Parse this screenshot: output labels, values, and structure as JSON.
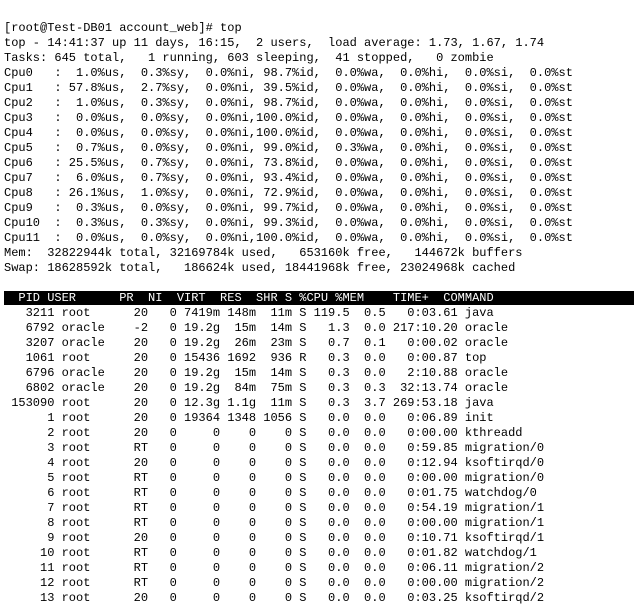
{
  "prompt": "[root@Test-DB01 account_web]# ",
  "cmd": "top",
  "summary": {
    "line1": "top - 14:41:37 up 11 days, 16:15,  2 users,  load average: 1.73, 1.67, 1.74",
    "line2": "Tasks: 645 total,   1 running, 603 sleeping,  41 stopped,   0 zombie"
  },
  "cpu": [
    {
      "n": "Cpu0 ",
      "us": " 1.0",
      "sy": "0.3",
      "ni": "0.0",
      "id": " 98.7",
      "wa": "0.0",
      "hi": "0.0",
      "si": "0.0",
      "st": "0.0"
    },
    {
      "n": "Cpu1 ",
      "us": "57.8",
      "sy": "2.7",
      "ni": "0.0",
      "id": " 39.5",
      "wa": "0.0",
      "hi": "0.0",
      "si": "0.0",
      "st": "0.0"
    },
    {
      "n": "Cpu2 ",
      "us": " 1.0",
      "sy": "0.3",
      "ni": "0.0",
      "id": " 98.7",
      "wa": "0.0",
      "hi": "0.0",
      "si": "0.0",
      "st": "0.0"
    },
    {
      "n": "Cpu3 ",
      "us": " 0.0",
      "sy": "0.0",
      "ni": "0.0",
      "id": "100.0",
      "wa": "0.0",
      "hi": "0.0",
      "si": "0.0",
      "st": "0.0"
    },
    {
      "n": "Cpu4 ",
      "us": " 0.0",
      "sy": "0.0",
      "ni": "0.0",
      "id": "100.0",
      "wa": "0.0",
      "hi": "0.0",
      "si": "0.0",
      "st": "0.0"
    },
    {
      "n": "Cpu5 ",
      "us": " 0.7",
      "sy": "0.0",
      "ni": "0.0",
      "id": " 99.0",
      "wa": "0.3",
      "hi": "0.0",
      "si": "0.0",
      "st": "0.0"
    },
    {
      "n": "Cpu6 ",
      "us": "25.5",
      "sy": "0.7",
      "ni": "0.0",
      "id": " 73.8",
      "wa": "0.0",
      "hi": "0.0",
      "si": "0.0",
      "st": "0.0"
    },
    {
      "n": "Cpu7 ",
      "us": " 6.0",
      "sy": "0.7",
      "ni": "0.0",
      "id": " 93.4",
      "wa": "0.0",
      "hi": "0.0",
      "si": "0.0",
      "st": "0.0"
    },
    {
      "n": "Cpu8 ",
      "us": "26.1",
      "sy": "1.0",
      "ni": "0.0",
      "id": " 72.9",
      "wa": "0.0",
      "hi": "0.0",
      "si": "0.0",
      "st": "0.0"
    },
    {
      "n": "Cpu9 ",
      "us": " 0.3",
      "sy": "0.0",
      "ni": "0.0",
      "id": " 99.7",
      "wa": "0.0",
      "hi": "0.0",
      "si": "0.0",
      "st": "0.0"
    },
    {
      "n": "Cpu10",
      "us": " 0.3",
      "sy": "0.3",
      "ni": "0.0",
      "id": " 99.3",
      "wa": "0.0",
      "hi": "0.0",
      "si": "0.0",
      "st": "0.0"
    },
    {
      "n": "Cpu11",
      "us": " 0.0",
      "sy": "0.0",
      "ni": "0.0",
      "id": "100.0",
      "wa": "0.0",
      "hi": "0.0",
      "si": "0.0",
      "st": "0.0"
    }
  ],
  "mem": {
    "line": "Mem:  32822944k total, 32169784k used,   653160k free,   144672k buffers",
    "swap": "Swap: 18628592k total,   186624k used, 18441968k free, 23024968k cached"
  },
  "header": "  PID USER      PR  NI  VIRT  RES  SHR S %CPU %MEM    TIME+  COMMAND",
  "rows": [
    {
      "pid": "   3211",
      "user": "root    ",
      "pr": "20",
      "ni": "  0",
      "virt": "7419m",
      "res": "148m",
      "shr": " 11m",
      "s": "S",
      "cpu": "119.5",
      "mem": "0.5",
      "time": "  0:03.61",
      "cmd": "java"
    },
    {
      "pid": "   6792",
      "user": "oracle  ",
      "pr": "-2",
      "ni": "  0",
      "virt": "19.2g",
      "res": " 15m",
      "shr": " 14m",
      "s": "S",
      "cpu": "  1.3",
      "mem": "0.0",
      "time": "217:10.20",
      "cmd": "oracle"
    },
    {
      "pid": "   3207",
      "user": "oracle  ",
      "pr": "20",
      "ni": "  0",
      "virt": "19.2g",
      "res": " 26m",
      "shr": " 23m",
      "s": "S",
      "cpu": "  0.7",
      "mem": "0.1",
      "time": "  0:00.02",
      "cmd": "oracle"
    },
    {
      "pid": "   1061",
      "user": "root    ",
      "pr": "20",
      "ni": "  0",
      "virt": "15436",
      "res": "1692",
      "shr": " 936",
      "s": "R",
      "cpu": "  0.3",
      "mem": "0.0",
      "time": "  0:00.87",
      "cmd": "top"
    },
    {
      "pid": "   6796",
      "user": "oracle  ",
      "pr": "20",
      "ni": "  0",
      "virt": "19.2g",
      "res": " 15m",
      "shr": " 14m",
      "s": "S",
      "cpu": "  0.3",
      "mem": "0.0",
      "time": "  2:10.88",
      "cmd": "oracle"
    },
    {
      "pid": "   6802",
      "user": "oracle  ",
      "pr": "20",
      "ni": "  0",
      "virt": "19.2g",
      "res": " 84m",
      "shr": " 75m",
      "s": "S",
      "cpu": "  0.3",
      "mem": "0.3",
      "time": " 32:13.74",
      "cmd": "oracle"
    },
    {
      "pid": " 153090",
      "user": "root    ",
      "pr": "20",
      "ni": "  0",
      "virt": "12.3g",
      "res": "1.1g",
      "shr": " 11m",
      "s": "S",
      "cpu": "  0.3",
      "mem": "3.7",
      "time": "269:53.18",
      "cmd": "java"
    },
    {
      "pid": "      1",
      "user": "root    ",
      "pr": "20",
      "ni": "  0",
      "virt": "19364",
      "res": "1348",
      "shr": "1056",
      "s": "S",
      "cpu": "  0.0",
      "mem": "0.0",
      "time": "  0:06.89",
      "cmd": "init"
    },
    {
      "pid": "      2",
      "user": "root    ",
      "pr": "20",
      "ni": "  0",
      "virt": "    0",
      "res": "   0",
      "shr": "   0",
      "s": "S",
      "cpu": "  0.0",
      "mem": "0.0",
      "time": "  0:00.00",
      "cmd": "kthreadd"
    },
    {
      "pid": "      3",
      "user": "root    ",
      "pr": "RT",
      "ni": "  0",
      "virt": "    0",
      "res": "   0",
      "shr": "   0",
      "s": "S",
      "cpu": "  0.0",
      "mem": "0.0",
      "time": "  0:59.85",
      "cmd": "migration/0"
    },
    {
      "pid": "      4",
      "user": "root    ",
      "pr": "20",
      "ni": "  0",
      "virt": "    0",
      "res": "   0",
      "shr": "   0",
      "s": "S",
      "cpu": "  0.0",
      "mem": "0.0",
      "time": "  0:12.94",
      "cmd": "ksoftirqd/0"
    },
    {
      "pid": "      5",
      "user": "root    ",
      "pr": "RT",
      "ni": "  0",
      "virt": "    0",
      "res": "   0",
      "shr": "   0",
      "s": "S",
      "cpu": "  0.0",
      "mem": "0.0",
      "time": "  0:00.00",
      "cmd": "migration/0"
    },
    {
      "pid": "      6",
      "user": "root    ",
      "pr": "RT",
      "ni": "  0",
      "virt": "    0",
      "res": "   0",
      "shr": "   0",
      "s": "S",
      "cpu": "  0.0",
      "mem": "0.0",
      "time": "  0:01.75",
      "cmd": "watchdog/0"
    },
    {
      "pid": "      7",
      "user": "root    ",
      "pr": "RT",
      "ni": "  0",
      "virt": "    0",
      "res": "   0",
      "shr": "   0",
      "s": "S",
      "cpu": "  0.0",
      "mem": "0.0",
      "time": "  0:54.19",
      "cmd": "migration/1"
    },
    {
      "pid": "      8",
      "user": "root    ",
      "pr": "RT",
      "ni": "  0",
      "virt": "    0",
      "res": "   0",
      "shr": "   0",
      "s": "S",
      "cpu": "  0.0",
      "mem": "0.0",
      "time": "  0:00.00",
      "cmd": "migration/1"
    },
    {
      "pid": "      9",
      "user": "root    ",
      "pr": "20",
      "ni": "  0",
      "virt": "    0",
      "res": "   0",
      "shr": "   0",
      "s": "S",
      "cpu": "  0.0",
      "mem": "0.0",
      "time": "  0:10.71",
      "cmd": "ksoftirqd/1"
    },
    {
      "pid": "     10",
      "user": "root    ",
      "pr": "RT",
      "ni": "  0",
      "virt": "    0",
      "res": "   0",
      "shr": "   0",
      "s": "S",
      "cpu": "  0.0",
      "mem": "0.0",
      "time": "  0:01.82",
      "cmd": "watchdog/1"
    },
    {
      "pid": "     11",
      "user": "root    ",
      "pr": "RT",
      "ni": "  0",
      "virt": "    0",
      "res": "   0",
      "shr": "   0",
      "s": "S",
      "cpu": "  0.0",
      "mem": "0.0",
      "time": "  0:06.11",
      "cmd": "migration/2"
    },
    {
      "pid": "     12",
      "user": "root    ",
      "pr": "RT",
      "ni": "  0",
      "virt": "    0",
      "res": "   0",
      "shr": "   0",
      "s": "S",
      "cpu": "  0.0",
      "mem": "0.0",
      "time": "  0:00.00",
      "cmd": "migration/2"
    },
    {
      "pid": "     13",
      "user": "root    ",
      "pr": "20",
      "ni": "  0",
      "virt": "    0",
      "res": "   0",
      "shr": "   0",
      "s": "S",
      "cpu": "  0.0",
      "mem": "0.0",
      "time": "  0:03.25",
      "cmd": "ksoftirqd/2"
    }
  ]
}
